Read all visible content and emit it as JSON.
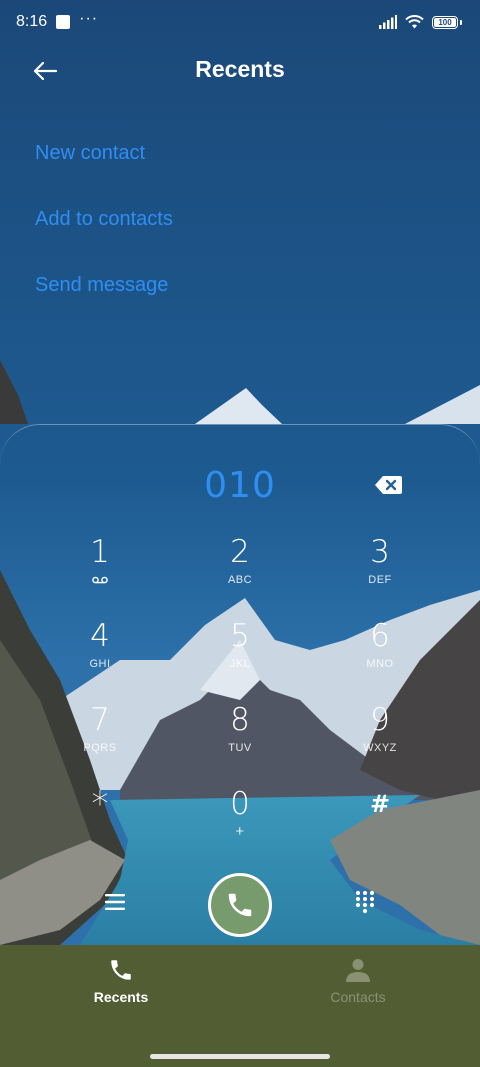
{
  "status_bar": {
    "time": "8:16",
    "dots": "···",
    "battery": "100"
  },
  "header": {
    "title": "Recents"
  },
  "actions": [
    {
      "label": "New contact"
    },
    {
      "label": "Add to contacts"
    },
    {
      "label": "Send message"
    }
  ],
  "dialer": {
    "number": "010",
    "keys": [
      {
        "digit": "1",
        "sub": ""
      },
      {
        "digit": "2",
        "sub": "ABC"
      },
      {
        "digit": "3",
        "sub": "DEF"
      },
      {
        "digit": "4",
        "sub": "GHI"
      },
      {
        "digit": "5",
        "sub": "JKL"
      },
      {
        "digit": "6",
        "sub": "MNO"
      },
      {
        "digit": "7",
        "sub": "PQRS"
      },
      {
        "digit": "8",
        "sub": "TUV"
      },
      {
        "digit": "9",
        "sub": "WXYZ"
      },
      {
        "digit": "*",
        "sub": ""
      },
      {
        "digit": "0",
        "sub": "+"
      },
      {
        "digit": "#",
        "sub": ""
      }
    ]
  },
  "bottom_nav": {
    "tabs": [
      {
        "label": "Recents",
        "icon": "phone-icon",
        "active": true
      },
      {
        "label": "Contacts",
        "icon": "person-icon",
        "active": false
      }
    ]
  },
  "colors": {
    "accent": "#2f8ef2",
    "call_button": "#789b6e",
    "nav_background": "#535d33",
    "inactive_tab": "#8a9172"
  }
}
